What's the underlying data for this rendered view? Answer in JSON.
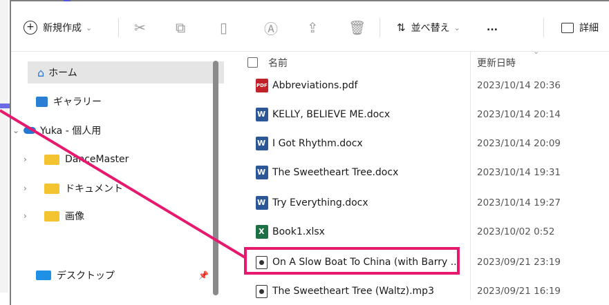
{
  "toolbar": {
    "new_label": "新規作成",
    "sort_label": "並べ替え",
    "more_label": "...",
    "details_label": "詳細"
  },
  "nav": {
    "items": [
      {
        "label": "ホーム"
      },
      {
        "label": "ギャラリー"
      },
      {
        "label": "Yuka - 個人用"
      },
      {
        "label": "DanceMaster"
      },
      {
        "label": "ドキュメント"
      },
      {
        "label": "画像"
      },
      {
        "label": "デスクトップ"
      }
    ]
  },
  "columns": {
    "name": "名前",
    "date": "更新日時"
  },
  "files": [
    {
      "name": "Abbreviations.pdf",
      "date": "2023/10/14 20:36",
      "type": "pdf"
    },
    {
      "name": "KELLY, BELIEVE ME.docx",
      "date": "2023/10/14 20:14",
      "type": "word"
    },
    {
      "name": "I Got Rhythm.docx",
      "date": "2023/10/14 20:09",
      "type": "word"
    },
    {
      "name": "The Sweetheart Tree.docx",
      "date": "2023/10/14 19:31",
      "type": "word"
    },
    {
      "name": "Try Everything.docx",
      "date": "2023/10/14 19:27",
      "type": "word"
    },
    {
      "name": "Book1.xlsx",
      "date": "2023/10/02 0:52",
      "type": "excel"
    },
    {
      "name": "On A Slow Boat To China (with Barry ...",
      "date": "2023/09/21 23:19",
      "type": "audio"
    },
    {
      "name": "The Sweetheart Tree (Waltz).mp3",
      "date": "2023/09/21 16:19",
      "type": "audio"
    }
  ],
  "colors": {
    "highlight": "#e6196e",
    "accent_blue": "#5353e0"
  }
}
